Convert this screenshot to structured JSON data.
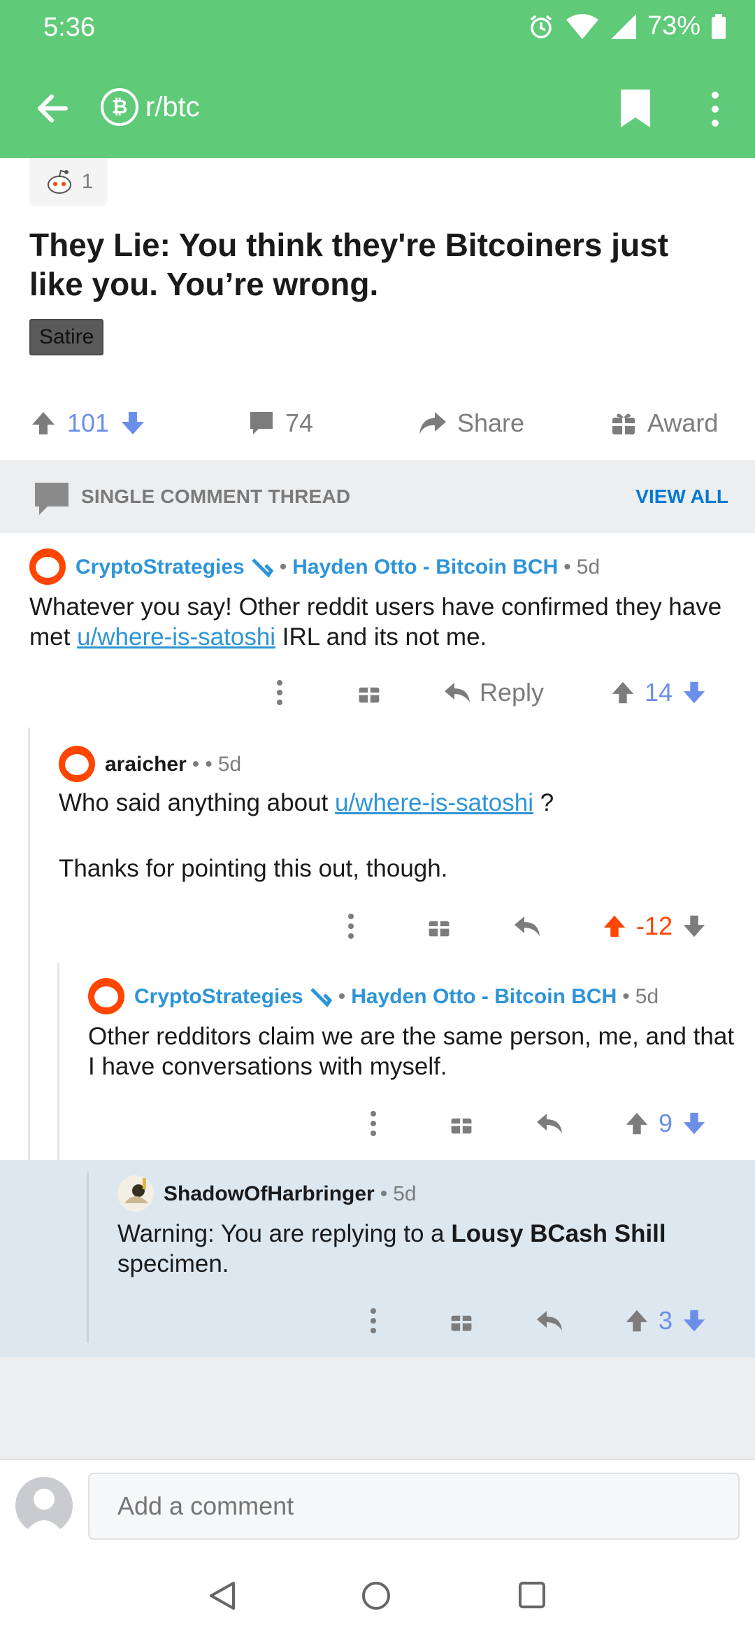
{
  "status_bar": {
    "time": "5:36",
    "battery": "73%"
  },
  "header": {
    "subreddit": "r/btc",
    "icon_letter": "₿"
  },
  "post": {
    "award_count": "1",
    "title": "They Lie: You think they're Bitcoiners just like you. You’re wrong.",
    "flair": "Satire",
    "score": "101",
    "comments": "74",
    "share_label": "Share",
    "award_label": "Award"
  },
  "thread": {
    "label": "SINGLE COMMENT THREAD",
    "view_all": "VIEW ALL"
  },
  "comments": [
    {
      "user": "CryptoStrategies",
      "flair": "Hayden Otto - Bitcoin BCH",
      "age": "5d",
      "body_pre": "Whatever you say! Other reddit users have confirmed they have met ",
      "body_link": "u/where-is-satoshi",
      "body_post": " IRL and its not me.",
      "reply_label": "Reply",
      "score": "14"
    },
    {
      "user": "araicher",
      "age": "5d",
      "body_pre": "Who said anything about ",
      "body_link": "u/where-is-satoshi",
      "body_post": " ?",
      "body_line2": "Thanks for pointing this out, though.",
      "score": "-12"
    },
    {
      "user": "CryptoStrategies",
      "flair": "Hayden Otto - Bitcoin BCH",
      "age": "5d",
      "body": "Other redditors claim we are the same person, me, and that I have conversations with myself.",
      "score": "9"
    },
    {
      "user": "ShadowOfHarbringer",
      "age": "5d",
      "body_pre": "Warning: You are replying to a ",
      "body_bold": "Lousy BCash Shill",
      "body_post": " specimen.",
      "score": "3"
    }
  ],
  "comment_bar": {
    "placeholder": "Add a comment"
  },
  "colors": {
    "header": "#5fca78",
    "link": "#2e94d8",
    "upvote_orange": "#ff4500",
    "vote_blue": "#6b8fe8"
  }
}
